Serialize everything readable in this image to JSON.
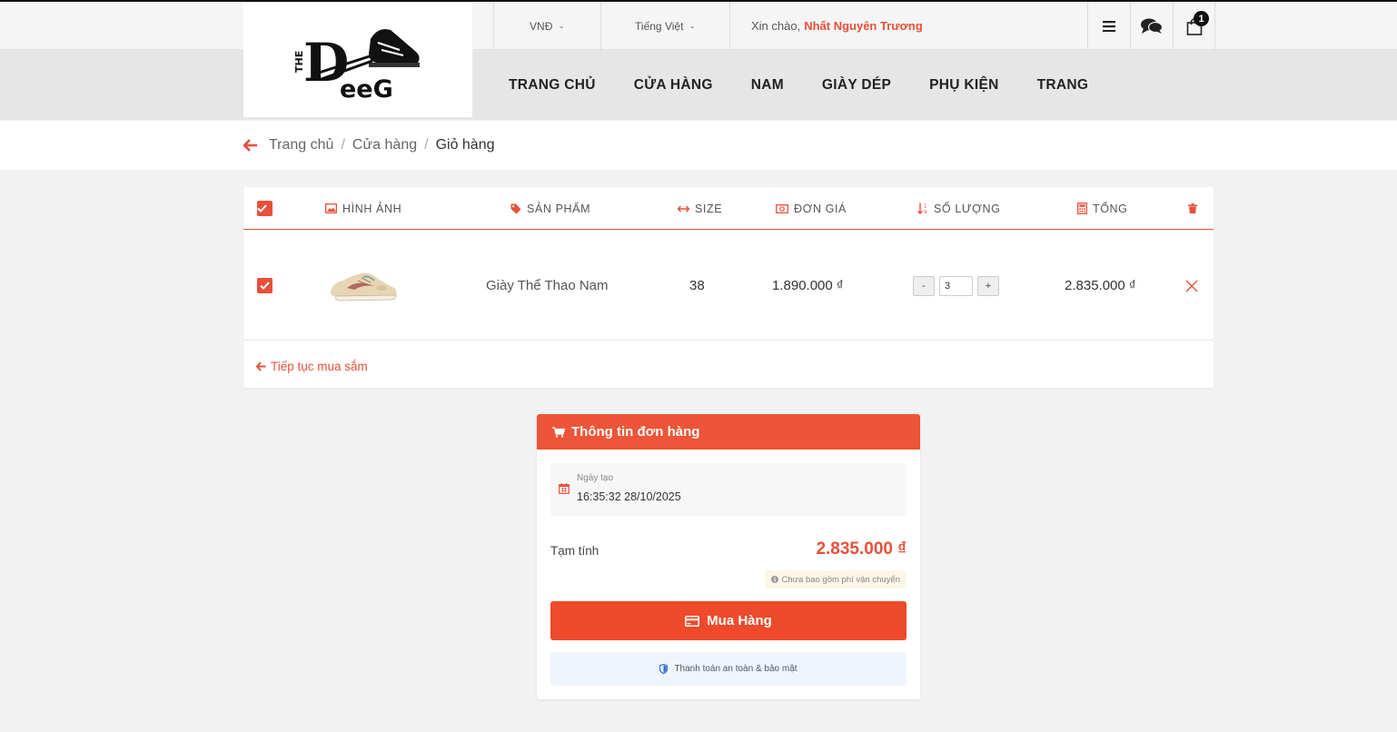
{
  "topbar": {
    "currency": "VNĐ",
    "language": "Tiếng Việt",
    "greeting": "Xin chào,",
    "username": "Nhất Nguyên Trương",
    "cart_count": "1"
  },
  "nav": {
    "items": [
      "TRANG CHỦ",
      "CỬA HÀNG",
      "NAM",
      "GIÀY DÉP",
      "PHỤ KIỆN",
      "TRANG"
    ]
  },
  "breadcrumb": {
    "items": [
      "Trang chủ",
      "Cửa hàng",
      "Giỏ hàng"
    ]
  },
  "cart": {
    "headers": {
      "image": "HÌNH ẢNH",
      "product": "SẢN PHẨM",
      "size": "SIZE",
      "price": "ĐƠN GIÁ",
      "quantity": "SỐ LƯỢNG",
      "total": "TỔNG"
    },
    "rows": [
      {
        "checked": true,
        "product": "Giày Thể Thao Nam",
        "size": "38",
        "price": "1.890.000 ₫",
        "quantity": "3",
        "total": "2.835.000 ₫"
      }
    ],
    "continue_label": "Tiếp tục mua sắm"
  },
  "order": {
    "title": "Thông tin đơn hàng",
    "date_label": "Ngày tạo",
    "date_value": "16:35:32 28/10/2025",
    "subtotal_label": "Tạm tính",
    "subtotal_value": "2.835.000 ₫",
    "shipping_note": "Chưa bao gồm phí vận chuyển",
    "buy_label": "Mua Hàng",
    "secure_note": "Thanh toán an toàn & bảo mật"
  },
  "colors": {
    "accent": "#e8503a",
    "header_bg": "#ee5437"
  }
}
